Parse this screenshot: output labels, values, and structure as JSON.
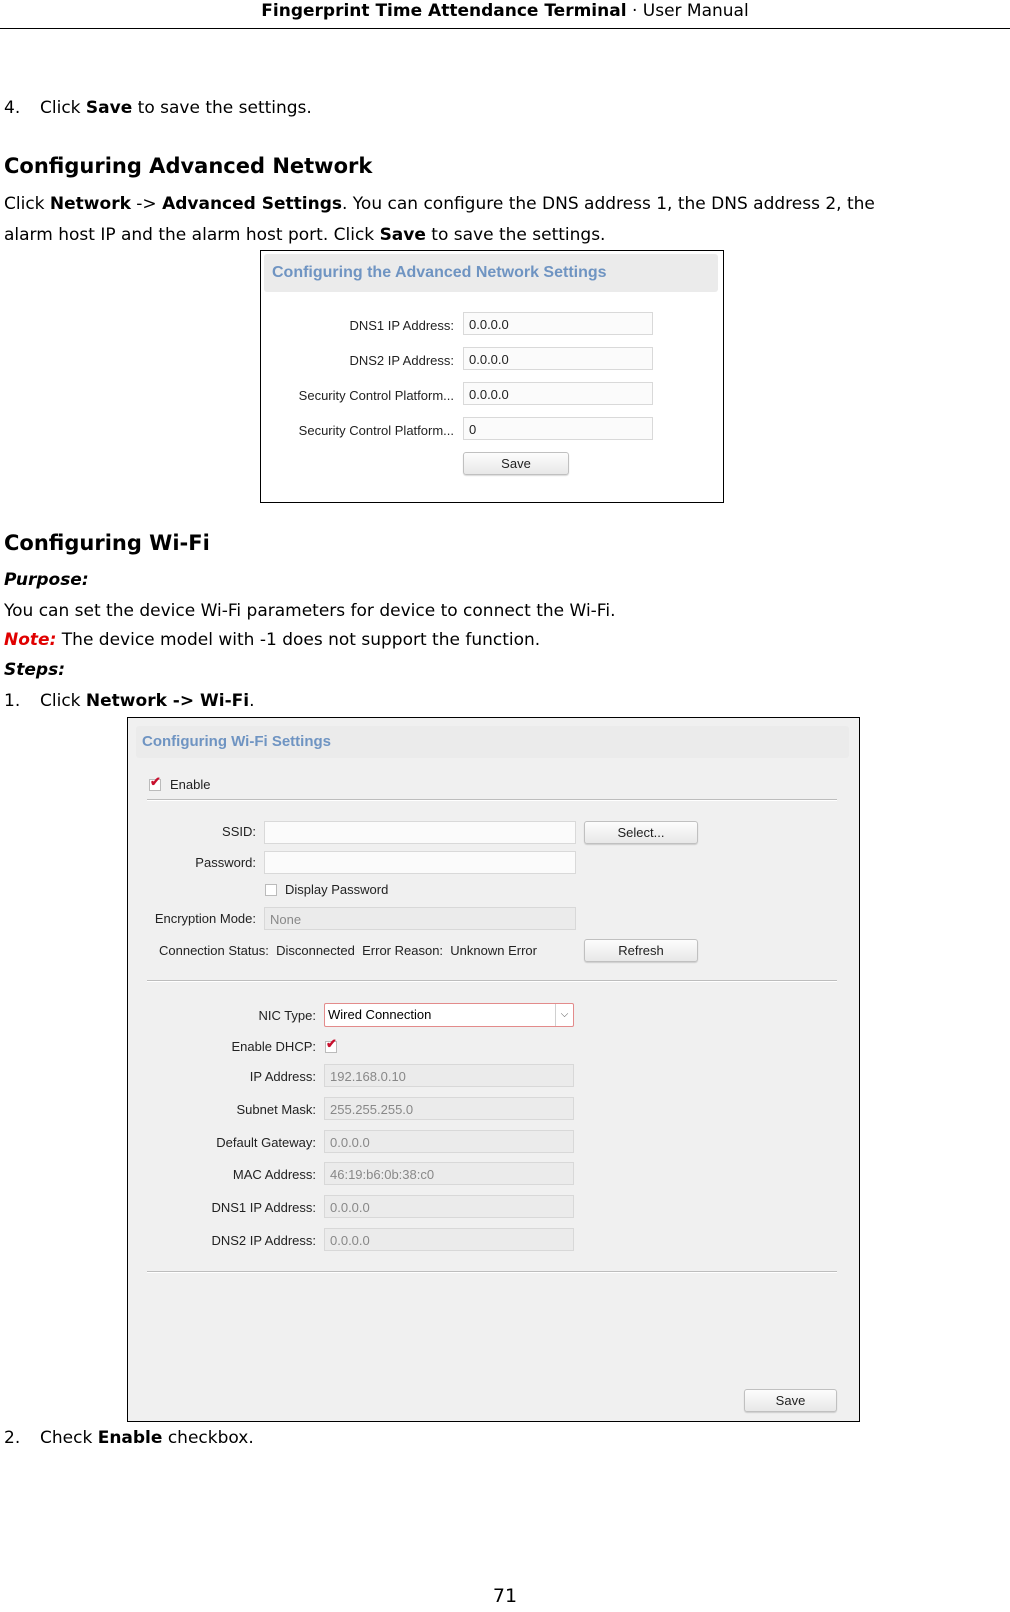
{
  "header": {
    "title_bold": "Fingerprint Time Attendance Terminal",
    "separator": "·",
    "title_rest": "User Manual"
  },
  "step4": {
    "number": "4.",
    "pre": "Click ",
    "bold": "Save",
    "post": " to save the settings."
  },
  "advanced": {
    "heading": "Configuring Advanced Network",
    "line1_pre": "Click ",
    "line1_b1": "Network",
    "line1_mid": " -> ",
    "line1_b2": "Advanced Settings",
    "line1_post": ". You can configure the DNS address 1, the DNS address 2, the",
    "line2_pre": "alarm host IP and the alarm host port. Click ",
    "line2_bold": "Save",
    "line2_post": " to save the settings.",
    "panel": {
      "title": "Configuring the Advanced Network Settings",
      "fields": [
        {
          "label": "DNS1 IP Address:",
          "value": "0.0.0.0"
        },
        {
          "label": "DNS2 IP Address:",
          "value": "0.0.0.0"
        },
        {
          "label": "Security Control Platform...",
          "value": "0.0.0.0"
        },
        {
          "label": "Security Control Platform...",
          "value": "0"
        }
      ],
      "save_label": "Save"
    }
  },
  "wifi": {
    "heading": "Configuring Wi-Fi",
    "purpose_label": "Purpose:",
    "purpose_text": "You can set the device Wi-Fi parameters for device to connect the Wi-Fi.",
    "note_label": "Note:",
    "note_text": " The device model with -1 does not support the function.",
    "steps_label": "Steps:",
    "step1": {
      "number": "1.",
      "pre": "Click ",
      "bold": "Network -> Wi-Fi",
      "post": "."
    },
    "panel": {
      "title": "Configuring Wi-Fi Settings",
      "enable_label": "Enable",
      "enable_checked": true,
      "ssid_label": "SSID:",
      "ssid_value": "",
      "select_button": "Select...",
      "password_label": "Password:",
      "password_value": "",
      "display_password_label": "Display Password",
      "display_password_checked": false,
      "encryption_label": "Encryption Mode:",
      "encryption_value": "None",
      "status_label": "Connection Status:",
      "status_value": "Disconnected",
      "error_label": "Error Reason:",
      "error_value": "Unknown Error",
      "refresh_button": "Refresh",
      "nic_label": "NIC Type:",
      "nic_value": "Wired Connection",
      "dhcp_label": "Enable DHCP:",
      "dhcp_checked": true,
      "fields": [
        {
          "label": "IP Address:",
          "value": "192.168.0.10"
        },
        {
          "label": "Subnet Mask:",
          "value": "255.255.255.0"
        },
        {
          "label": "Default Gateway:",
          "value": "0.0.0.0"
        },
        {
          "label": "MAC Address:",
          "value": "46:19:b6:0b:38:c0"
        },
        {
          "label": "DNS1 IP Address:",
          "value": "0.0.0.0"
        },
        {
          "label": "DNS2 IP Address:",
          "value": "0.0.0.0"
        }
      ],
      "save_label": "Save"
    },
    "step2": {
      "number": "2.",
      "pre": "Check ",
      "bold": "Enable",
      "post": " checkbox."
    }
  },
  "page_number": "71",
  "colors": {
    "panel_title": "#6f94c2",
    "note_red": "#e00000",
    "check_red": "#c8102e"
  }
}
